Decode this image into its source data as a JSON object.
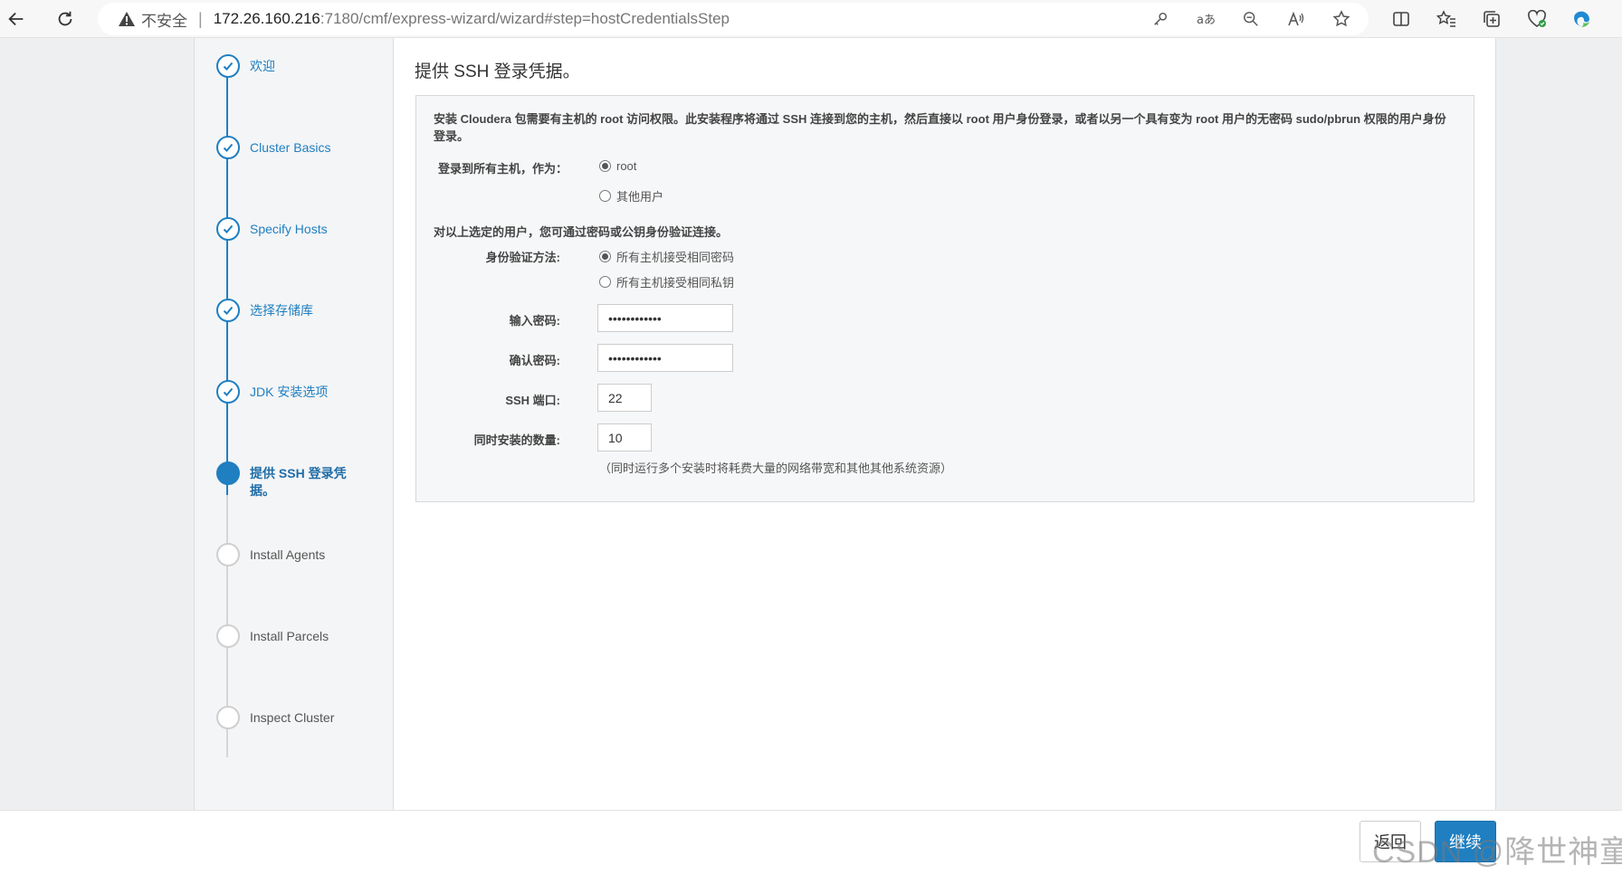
{
  "browser": {
    "insecure_label": "不安全",
    "url_host": "172.26.160.216",
    "url_path": ":7180/cmf/express-wizard/wizard#step=hostCredentialsStep"
  },
  "sidebar": {
    "steps": [
      {
        "label": "欢迎",
        "state": "done"
      },
      {
        "label": "Cluster Basics",
        "state": "done"
      },
      {
        "label": "Specify Hosts",
        "state": "done"
      },
      {
        "label": "选择存储库",
        "state": "done"
      },
      {
        "label": "JDK 安装选项",
        "state": "done"
      },
      {
        "label": "提供 SSH 登录凭据。",
        "state": "active"
      },
      {
        "label": "Install Agents",
        "state": "pending"
      },
      {
        "label": "Install Parcels",
        "state": "pending"
      },
      {
        "label": "Inspect Cluster",
        "state": "pending"
      }
    ]
  },
  "main": {
    "title": "提供 SSH 登录凭据。",
    "description": "安装 Cloudera 包需要有主机的 root 访问权限。此安装程序将通过 SSH 连接到您的主机，然后直接以 root 用户身份登录，或者以另一个具有变为 root 用户的无密码 sudo/pbrun 权限的用户身份登录。",
    "login_label": "登录到所有主机，作为：",
    "login_options": [
      {
        "label": "root",
        "selected": true
      },
      {
        "label": "其他用户",
        "selected": false
      }
    ],
    "auth_note": "对以上选定的用户，您可通过密码或公钥身份验证连接。",
    "auth_label": "身份验证方法:",
    "auth_options": [
      {
        "label": "所有主机接受相同密码",
        "selected": true
      },
      {
        "label": "所有主机接受相同私钥",
        "selected": false
      }
    ],
    "password_label": "输入密码:",
    "password_value": "••••••••••••",
    "confirm_label": "确认密码:",
    "confirm_value": "••••••••••••",
    "ssh_port_label": "SSH 端口:",
    "ssh_port_value": "22",
    "concurrency_label": "同时安装的数量:",
    "concurrency_value": "10",
    "concurrency_hint": "（同时运行多个安装时将耗费大量的网络带宽和其他其他系统资源）"
  },
  "footer": {
    "back_label": "返回",
    "next_label": "继续",
    "watermark": "CSDN @降世神童"
  },
  "colors": {
    "accent": "#1f7fc1"
  }
}
